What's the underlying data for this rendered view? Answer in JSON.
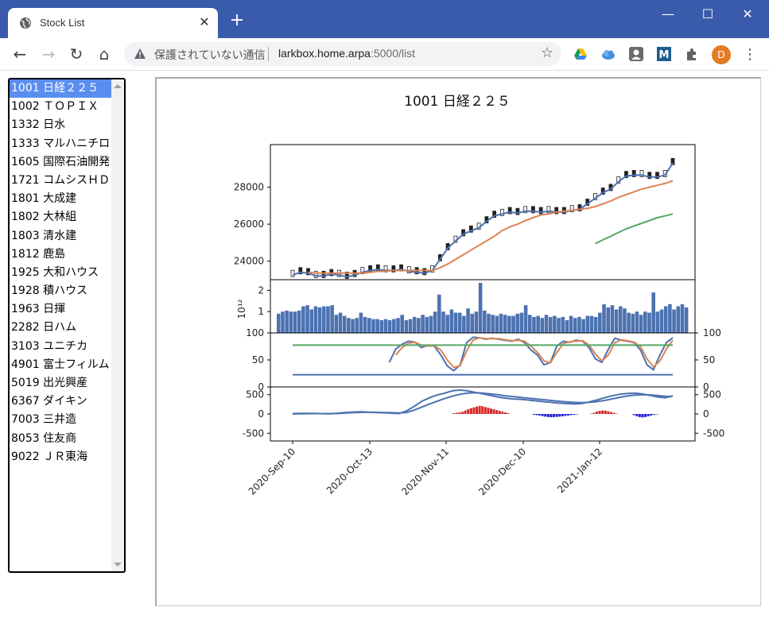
{
  "browser": {
    "tab_title": "Stock List",
    "security_label": "保護されていない通信",
    "url_host": "larkbox.home.arpa",
    "url_path": ":5000/list",
    "profile_initial": "D"
  },
  "stock_list": {
    "items": [
      "1001 日経２２５",
      "1002 ＴＯＰＩＸ",
      "1332 日水",
      "1333 マルハニチロ",
      "1605 国際石油開発",
      "1721 コムシスＨＤ",
      "1801 大成建",
      "1802 大林組",
      "1803 清水建",
      "1812 鹿島",
      "1925 大和ハウス",
      "1928 積ハウス",
      "1963 日揮",
      "2282 日ハム",
      "3103 ユニチカ",
      "4901 富士フィルム",
      "5019 出光興産",
      "6367 ダイキン",
      "7003 三井造",
      "8053 住友商",
      "9022 ＪＲ東海"
    ],
    "selected_index": 0
  },
  "chart_data": {
    "type": "line",
    "title": "1001 日経２２５",
    "x_ticks": [
      "2020-Sep-10",
      "2020-Oct-13",
      "2020-Nov-11",
      "2020-Dec-10",
      "2021-Jan-12"
    ],
    "price_panel": {
      "yticks": [
        24000,
        26000,
        28000
      ],
      "ylim": [
        23000,
        30300
      ],
      "series": [
        {
          "color": "#4c72b0",
          "values": [
            23250,
            23400,
            23350,
            23200,
            23200,
            23300,
            23250,
            23150,
            23250,
            23400,
            23500,
            23550,
            23500,
            23500,
            23550,
            23450,
            23400,
            23350,
            23500,
            24100,
            24700,
            25100,
            25450,
            25650,
            25800,
            26150,
            26450,
            26550,
            26650,
            26600,
            26700,
            26700,
            26650,
            26700,
            26650,
            26650,
            26750,
            26800,
            27100,
            27400,
            27700,
            27900,
            28300,
            28600,
            28650,
            28650,
            28550,
            28550,
            28650,
            29300
          ]
        },
        {
          "color": "#dd8452",
          "values": [
            null,
            null,
            23400,
            23350,
            23350,
            23350,
            23350,
            23350,
            23350,
            23350,
            23400,
            23450,
            23450,
            23500,
            23500,
            23500,
            23500,
            23500,
            23500,
            23650,
            23850,
            24100,
            24350,
            24600,
            24850,
            25100,
            25350,
            25650,
            25850,
            26000,
            26200,
            26350,
            26500,
            26550,
            26650,
            26700,
            26750,
            26800,
            26850,
            26950,
            27100,
            27250,
            27450,
            27600,
            27750,
            27900,
            28000,
            28100,
            28200,
            28350
          ]
        },
        {
          "color": "#55a868",
          "values": [
            null,
            null,
            null,
            null,
            null,
            null,
            null,
            null,
            null,
            null,
            null,
            null,
            null,
            null,
            null,
            null,
            null,
            null,
            null,
            null,
            null,
            null,
            null,
            null,
            null,
            null,
            null,
            null,
            null,
            null,
            null,
            null,
            null,
            null,
            null,
            null,
            null,
            null,
            null,
            24950,
            25150,
            25350,
            25550,
            25750,
            25900,
            26050,
            26200,
            26350,
            26450,
            26550
          ]
        }
      ]
    },
    "volume_panel": {
      "yticks": [
        1,
        2
      ],
      "ylim": [
        0,
        2.5
      ],
      "exponent_label": "10¹²",
      "color": "#4c72b0",
      "values": [
        0.9,
        1.0,
        1.05,
        1.0,
        1.0,
        1.05,
        1.25,
        1.3,
        1.1,
        1.25,
        1.2,
        1.25,
        1.25,
        1.3,
        0.85,
        0.95,
        0.8,
        0.7,
        0.65,
        0.7,
        0.95,
        0.75,
        0.7,
        0.65,
        0.65,
        0.6,
        0.65,
        0.6,
        0.65,
        0.7,
        0.85,
        0.6,
        0.65,
        0.75,
        0.7,
        0.85,
        0.75,
        0.8,
        1.0,
        1.8,
        1.0,
        0.85,
        1.1,
        0.95,
        0.95,
        0.8,
        1.15,
        0.9,
        1.0,
        2.35,
        1.05,
        0.9,
        0.85,
        0.8,
        0.9,
        0.85,
        0.8,
        0.8,
        0.9,
        0.95,
        1.3,
        0.85,
        0.75,
        0.8,
        0.7,
        0.85,
        0.75,
        0.8,
        0.7,
        0.75,
        0.6,
        0.8,
        0.7,
        0.75,
        0.65,
        0.8,
        0.8,
        0.75,
        0.95,
        1.35,
        1.2,
        1.3,
        1.1,
        1.25,
        1.15,
        0.95,
        0.9,
        1.0,
        0.85,
        1.0,
        0.95,
        1.9,
        1.0,
        1.1,
        1.25,
        1.35,
        1.1,
        1.25,
        1.35,
        1.2
      ]
    },
    "oscillator_panel": {
      "yticks": [
        0,
        50,
        100
      ],
      "ylim": [
        0,
        100
      ],
      "series": [
        {
          "color": "#4c72b0",
          "values": [
            null,
            null,
            null,
            null,
            null,
            null,
            null,
            null,
            null,
            null,
            null,
            null,
            null,
            null,
            null,
            45,
            72,
            82,
            88,
            86,
            75,
            80,
            78,
            60,
            38,
            28,
            40,
            85,
            96,
            95,
            92,
            94,
            92,
            90,
            88,
            92,
            85,
            70,
            60,
            40,
            45,
            78,
            88,
            86,
            90,
            88,
            75,
            52,
            45,
            72,
            94,
            90,
            88,
            85,
            70,
            40,
            30,
            60,
            85,
            95
          ]
        },
        {
          "color": "#dd8452",
          "values": [
            null,
            null,
            null,
            null,
            null,
            null,
            null,
            null,
            null,
            null,
            null,
            null,
            null,
            null,
            null,
            null,
            60,
            75,
            84,
            86,
            80,
            78,
            79,
            70,
            50,
            35,
            38,
            68,
            90,
            95,
            93,
            93,
            93,
            91,
            89,
            90,
            88,
            78,
            65,
            48,
            44,
            65,
            83,
            87,
            88,
            89,
            80,
            62,
            48,
            60,
            85,
            91,
            89,
            86,
            77,
            52,
            36,
            48,
            72,
            90
          ]
        },
        {
          "color": "#55a868",
          "values": [
            80,
            80,
            80,
            80,
            80,
            80,
            80,
            80,
            80,
            80,
            80,
            80,
            80,
            80,
            80,
            80,
            80,
            80,
            80,
            80,
            80,
            80,
            80,
            80,
            80,
            80,
            80,
            80,
            80,
            80,
            80,
            80,
            80,
            80,
            80,
            80,
            80,
            80,
            80,
            80,
            80,
            80,
            80,
            80,
            80,
            80,
            80,
            80,
            80,
            80,
            80,
            80,
            80,
            80,
            80,
            80,
            80,
            80,
            80,
            80
          ]
        },
        {
          "color": "#4c72b0",
          "values": [
            20,
            20,
            20,
            20,
            20,
            20,
            20,
            20,
            20,
            20,
            20,
            20,
            20,
            20,
            20,
            20,
            20,
            20,
            20,
            20,
            20,
            20,
            20,
            20,
            20,
            20,
            20,
            20,
            20,
            20,
            20,
            20,
            20,
            20,
            20,
            20,
            20,
            20,
            20,
            20,
            20,
            20,
            20,
            20,
            20,
            20,
            20,
            20,
            20,
            20,
            20,
            20,
            20,
            20,
            20,
            20,
            20,
            20,
            20,
            20
          ]
        }
      ]
    },
    "macd_panel": {
      "yticks": [
        -500,
        0,
        500
      ],
      "ylim": [
        -700,
        700
      ],
      "lines": [
        {
          "color": "#4c72b0",
          "values": [
            10,
            15,
            15,
            12,
            8,
            5,
            20,
            40,
            50,
            55,
            45,
            40,
            30,
            20,
            10,
            80,
            200,
            330,
            420,
            490,
            540,
            600,
            620,
            600,
            560,
            520,
            480,
            440,
            410,
            390,
            380,
            360,
            340,
            320,
            300,
            280,
            270,
            260,
            270,
            310,
            360,
            420,
            470,
            510,
            530,
            540,
            520,
            480,
            440,
            420,
            470
          ]
        },
        {
          "color": "#4c72b0",
          "values": [
            0,
            5,
            8,
            10,
            10,
            8,
            12,
            25,
            35,
            42,
            43,
            42,
            38,
            32,
            25,
            40,
            100,
            180,
            260,
            330,
            400,
            460,
            510,
            540,
            550,
            540,
            520,
            500,
            470,
            450,
            430,
            410,
            390,
            370,
            350,
            330,
            315,
            300,
            295,
            300,
            320,
            350,
            390,
            430,
            465,
            490,
            500,
            495,
            480,
            460,
            455
          ]
        }
      ],
      "hist_positive_color": "#d62728",
      "hist_negative_color": "#1f1fd8",
      "histogram": [
        0,
        0,
        0,
        0,
        0,
        0,
        0,
        0,
        0,
        0,
        0,
        0,
        0,
        0,
        0,
        0,
        0,
        0,
        0,
        0,
        0,
        0,
        0,
        0,
        0,
        0,
        0,
        0,
        0,
        0,
        0,
        0,
        0,
        0,
        0,
        0,
        0,
        0,
        0,
        0,
        0,
        0,
        0,
        0,
        0,
        0,
        0,
        0,
        0,
        0,
        0,
        0,
        0,
        0,
        0,
        0,
        20,
        30,
        40,
        55,
        90,
        120,
        150,
        170,
        190,
        210,
        200,
        180,
        160,
        140,
        120,
        100,
        80,
        60,
        40,
        20,
        0,
        0,
        0,
        0,
        0,
        0,
        0,
        0,
        -20,
        -30,
        -40,
        -55,
        -70,
        -80,
        -85,
        -80,
        -75,
        -70,
        -60,
        -50,
        -40,
        -30,
        -20,
        -10,
        0,
        0,
        0,
        0,
        10,
        30,
        60,
        80,
        90,
        85,
        70,
        50,
        30,
        10,
        0,
        0,
        0,
        0,
        0,
        -30,
        -60,
        -80,
        -90,
        -80,
        -60,
        -40,
        -20,
        -10,
        0,
        0,
        0,
        0,
        0
      ]
    }
  }
}
